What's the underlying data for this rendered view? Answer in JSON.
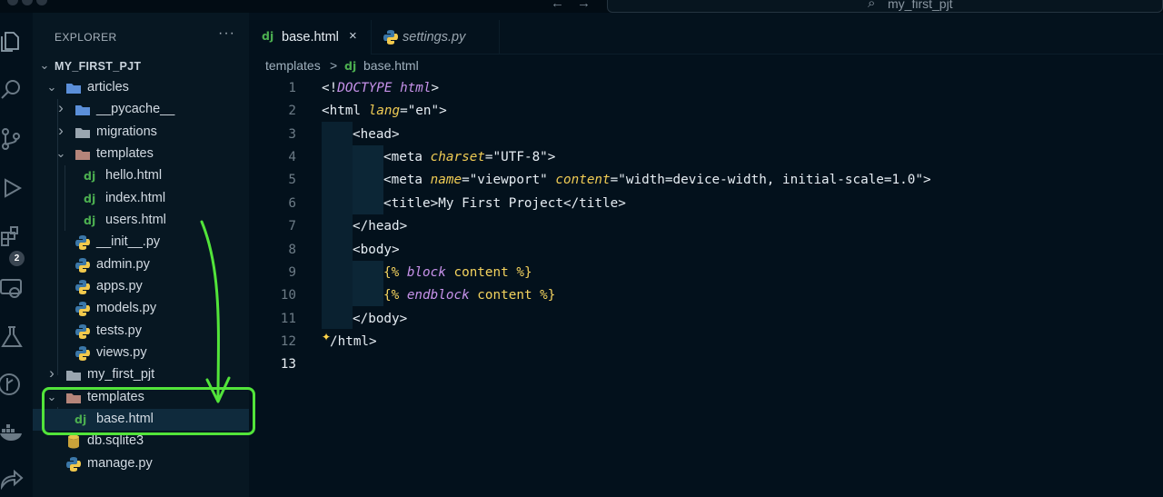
{
  "window": {
    "search_label": "my_first_pjt"
  },
  "activity_bar": {
    "items": [
      "explorer-icon",
      "search-icon",
      "source-control-icon",
      "run-debug-icon",
      "extensions-icon",
      "remote-explorer-icon",
      "testing-icon",
      "git-graph-icon",
      "docker-icon",
      "live-share-icon"
    ],
    "extensions_badge": "2"
  },
  "explorer": {
    "title": "EXPLORER",
    "more": "···",
    "project": "MY_FIRST_PJT",
    "tree": [
      {
        "label": "articles",
        "kind": "folder",
        "expanded": true
      },
      {
        "label": "__pycache__",
        "kind": "folder",
        "expanded": false
      },
      {
        "label": "migrations",
        "kind": "folder",
        "expanded": false
      },
      {
        "label": "templates",
        "kind": "folder",
        "expanded": true
      },
      {
        "label": "hello.html",
        "kind": "django"
      },
      {
        "label": "index.html",
        "kind": "django"
      },
      {
        "label": "users.html",
        "kind": "django"
      },
      {
        "label": "__init__.py",
        "kind": "python"
      },
      {
        "label": "admin.py",
        "kind": "python"
      },
      {
        "label": "apps.py",
        "kind": "python"
      },
      {
        "label": "models.py",
        "kind": "python"
      },
      {
        "label": "tests.py",
        "kind": "python"
      },
      {
        "label": "views.py",
        "kind": "python"
      },
      {
        "label": "my_first_pjt",
        "kind": "folder",
        "expanded": false
      },
      {
        "label": "templates",
        "kind": "folder",
        "expanded": true
      },
      {
        "label": "base.html",
        "kind": "django",
        "selected": true
      },
      {
        "label": "db.sqlite3",
        "kind": "database"
      },
      {
        "label": "manage.py",
        "kind": "python"
      }
    ]
  },
  "tabs": [
    {
      "label": "base.html",
      "icon": "dj",
      "active": true,
      "close": "×"
    },
    {
      "label": "settings.py",
      "icon": "python-icon",
      "active": false
    }
  ],
  "breadcrumb": {
    "folder": "templates",
    "separator": ">",
    "icon": "dj",
    "file": "base.html"
  },
  "code": {
    "lines": [
      {
        "n": "1"
      },
      {
        "n": "2"
      },
      {
        "n": "3"
      },
      {
        "n": "4"
      },
      {
        "n": "5"
      },
      {
        "n": "6"
      },
      {
        "n": "7"
      },
      {
        "n": "8"
      },
      {
        "n": "9"
      },
      {
        "n": "10"
      },
      {
        "n": "11"
      },
      {
        "n": "12"
      },
      {
        "n": "13",
        "current": true
      }
    ],
    "tokens": {
      "doctype_open": "<!",
      "doctype_kw": "DOCTYPE html",
      "doctype_close": ">",
      "html_open": "<html ",
      "lang_attr": "lang",
      "lang_eq": "=",
      "lang_val": "\"en\"",
      "html_open_close": ">",
      "head_open": "<head>",
      "meta1_open": "<meta ",
      "charset_attr": "charset",
      "charset_eq": "=",
      "charset_val": "\"UTF-8\"",
      "meta1_close": ">",
      "meta2_open": "<meta ",
      "name_attr": "name",
      "name_eq": "=",
      "name_val": "\"viewport\" ",
      "content_attr": "content",
      "content_eq": "=",
      "content_val": "\"width=device-width, initial-scale=1.0\"",
      "meta2_close": ">",
      "title_line": "<title>My First Project</title>",
      "head_close": "</head>",
      "body_open": "<body>",
      "block_open": "{% ",
      "block_kw": "block",
      "block_rest": " content %}",
      "endblock_open": "{% ",
      "endblock_kw": "endblock",
      "endblock_rest": " content %}",
      "body_close": "</body>",
      "html_close": "/html>"
    }
  },
  "annotation": {
    "color": "#52e43a"
  }
}
